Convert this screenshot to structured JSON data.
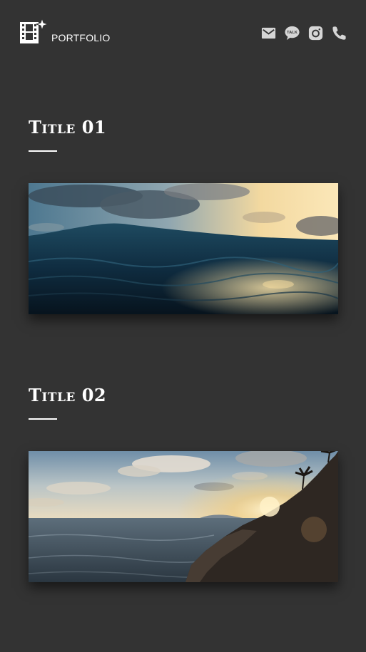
{
  "header": {
    "brand_label": "PORTFOLIO",
    "brand_icon": "film-sparkle-icon",
    "nav_icons": [
      "mail-icon",
      "talk-chat-icon",
      "instagram-icon",
      "phone-icon"
    ],
    "talk_badge_text": "TALK"
  },
  "sections": [
    {
      "title": "Title 01",
      "image": "ocean-wave-sunset"
    },
    {
      "title": "Title 02",
      "image": "rocky-coast-sunset"
    }
  ],
  "colors": {
    "background": "#333333",
    "text": "#ffffff",
    "icon": "#d6d6d6"
  }
}
